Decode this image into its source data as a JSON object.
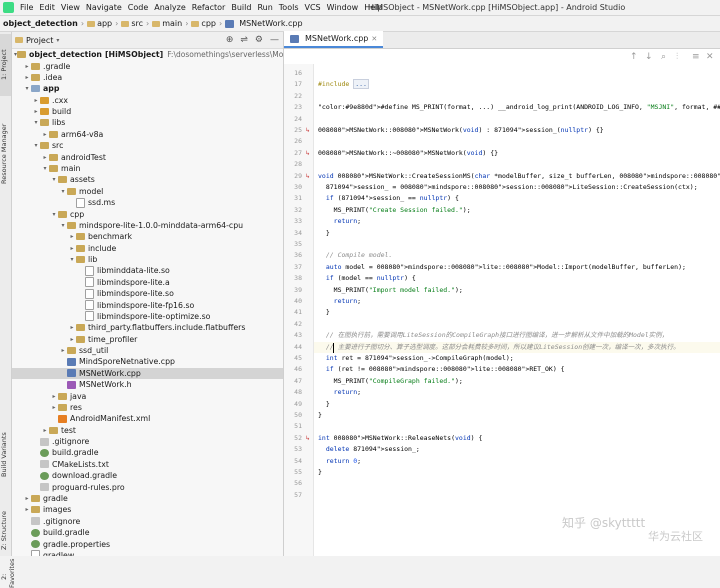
{
  "menubar": {
    "items": [
      "File",
      "Edit",
      "View",
      "Navigate",
      "Code",
      "Analyze",
      "Refactor",
      "Build",
      "Run",
      "Tools",
      "VCS",
      "Window",
      "Help"
    ],
    "window_title": "HiMSObject - MSNetWork.cpp [HiMSObject.app] - Android Studio"
  },
  "breadcrumb": [
    "object_detection",
    "app",
    "src",
    "main",
    "cpp",
    "MSNetWork.cpp"
  ],
  "side_tabs": {
    "project": "1: Project",
    "resource_manager": "Resource Manager",
    "build_variants": "Build Variants",
    "structure": "Z: Structure",
    "favorites": "2: Favorites"
  },
  "project_panel": {
    "title": "Project"
  },
  "tree": [
    {
      "indent": 0,
      "arrow": "▾",
      "icon": "folder",
      "label": "object_detection",
      "bold": true,
      "suffix": "[HiMSObject]",
      "path": "F:\\dosomethings\\serverless\\ModelArts\\Ml"
    },
    {
      "indent": 1,
      "arrow": "▸",
      "icon": "folder",
      "label": ".gradle"
    },
    {
      "indent": 1,
      "arrow": "▸",
      "icon": "folder",
      "label": ".idea"
    },
    {
      "indent": 1,
      "arrow": "▾",
      "icon": "folder-b",
      "label": "app",
      "bold": true
    },
    {
      "indent": 2,
      "arrow": "▸",
      "icon": "folder-o",
      "label": ".cxx"
    },
    {
      "indent": 2,
      "arrow": "▸",
      "icon": "folder-o",
      "label": "build"
    },
    {
      "indent": 2,
      "arrow": "▾",
      "icon": "folder",
      "label": "libs"
    },
    {
      "indent": 3,
      "arrow": "▸",
      "icon": "folder",
      "label": "arm64-v8a"
    },
    {
      "indent": 2,
      "arrow": "▾",
      "icon": "folder",
      "label": "src"
    },
    {
      "indent": 3,
      "arrow": "▸",
      "icon": "folder",
      "label": "androidTest"
    },
    {
      "indent": 3,
      "arrow": "▾",
      "icon": "folder",
      "label": "main"
    },
    {
      "indent": 4,
      "arrow": "▾",
      "icon": "folder",
      "label": "assets"
    },
    {
      "indent": 5,
      "arrow": "▾",
      "icon": "folder",
      "label": "model"
    },
    {
      "indent": 6,
      "arrow": "",
      "icon": "file",
      "label": "ssd.ms"
    },
    {
      "indent": 4,
      "arrow": "▾",
      "icon": "folder",
      "label": "cpp"
    },
    {
      "indent": 5,
      "arrow": "▾",
      "icon": "folder",
      "label": "mindspore-lite-1.0.0-minddata-arm64-cpu"
    },
    {
      "indent": 6,
      "arrow": "▸",
      "icon": "folder",
      "label": "benchmark"
    },
    {
      "indent": 6,
      "arrow": "▸",
      "icon": "folder",
      "label": "include"
    },
    {
      "indent": 6,
      "arrow": "▾",
      "icon": "folder",
      "label": "lib"
    },
    {
      "indent": 7,
      "arrow": "",
      "icon": "file",
      "label": "libminddata-lite.so"
    },
    {
      "indent": 7,
      "arrow": "",
      "icon": "file",
      "label": "libmindspore-lite.a"
    },
    {
      "indent": 7,
      "arrow": "",
      "icon": "file",
      "label": "libmindspore-lite.so"
    },
    {
      "indent": 7,
      "arrow": "",
      "icon": "file",
      "label": "libmindspore-lite-fp16.so"
    },
    {
      "indent": 7,
      "arrow": "",
      "icon": "file",
      "label": "libmindspore-lite-optimize.so"
    },
    {
      "indent": 6,
      "arrow": "▸",
      "icon": "folder",
      "label": "third_party.flatbuffers.include.flatbuffers"
    },
    {
      "indent": 6,
      "arrow": "▸",
      "icon": "folder",
      "label": "time_profiler"
    },
    {
      "indent": 5,
      "arrow": "▸",
      "icon": "folder",
      "label": "ssd_util"
    },
    {
      "indent": 5,
      "arrow": "",
      "icon": "cpp",
      "label": "MindSporeNetnative.cpp"
    },
    {
      "indent": 5,
      "arrow": "",
      "icon": "cpp",
      "label": "MSNetWork.cpp",
      "selected": true
    },
    {
      "indent": 5,
      "arrow": "",
      "icon": "h",
      "label": "MSNetWork.h"
    },
    {
      "indent": 4,
      "arrow": "▸",
      "icon": "folder",
      "label": "java"
    },
    {
      "indent": 4,
      "arrow": "▸",
      "icon": "folder",
      "label": "res"
    },
    {
      "indent": 4,
      "arrow": "",
      "icon": "xml",
      "label": "AndroidManifest.xml"
    },
    {
      "indent": 3,
      "arrow": "▸",
      "icon": "folder",
      "label": "test"
    },
    {
      "indent": 2,
      "arrow": "",
      "icon": "txt",
      "label": ".gitignore"
    },
    {
      "indent": 2,
      "arrow": "",
      "icon": "gradle",
      "label": "build.gradle"
    },
    {
      "indent": 2,
      "arrow": "",
      "icon": "txt",
      "label": "CMakeLists.txt"
    },
    {
      "indent": 2,
      "arrow": "",
      "icon": "gradle",
      "label": "download.gradle"
    },
    {
      "indent": 2,
      "arrow": "",
      "icon": "txt",
      "label": "proguard-rules.pro"
    },
    {
      "indent": 1,
      "arrow": "▸",
      "icon": "folder",
      "label": "gradle"
    },
    {
      "indent": 1,
      "arrow": "▸",
      "icon": "folder",
      "label": "images"
    },
    {
      "indent": 1,
      "arrow": "",
      "icon": "txt",
      "label": ".gitignore"
    },
    {
      "indent": 1,
      "arrow": "",
      "icon": "gradle",
      "label": "build.gradle"
    },
    {
      "indent": 1,
      "arrow": "",
      "icon": "gradle",
      "label": "gradle.properties"
    },
    {
      "indent": 1,
      "arrow": "",
      "icon": "file",
      "label": "gradlew"
    }
  ],
  "editor": {
    "tab_label": "MSNetWork.cpp",
    "lines": [
      {
        "n": "16",
        "text": ""
      },
      {
        "n": "17",
        "text": "#include ...",
        "fold": true
      },
      {
        "n": "22",
        "text": ""
      },
      {
        "n": "23",
        "text": "#define MS_PRINT(format, ...) __android_log_print(ANDROID_LOG_INFO, \"MSJNI\", format, ##__VA_ARGS__)"
      },
      {
        "n": "24",
        "text": ""
      },
      {
        "n": "25",
        "text": "MSNetWork::MSNetWork(void) : session_(nullptr) {}",
        "mark": "↳"
      },
      {
        "n": "26",
        "text": ""
      },
      {
        "n": "27",
        "text": "MSNetWork::~MSNetWork(void) {}",
        "mark": "↳"
      },
      {
        "n": "28",
        "text": ""
      },
      {
        "n": "29",
        "text": "void MSNetWork::CreateSessionMS(char *modelBuffer, size_t bufferLen, mindspore::lite::Context *ctx) {",
        "mark": "↳"
      },
      {
        "n": "30",
        "text": "  session_ = mindspore::session::LiteSession::CreateSession(ctx);"
      },
      {
        "n": "31",
        "text": "  if (session_ == nullptr) {"
      },
      {
        "n": "32",
        "text": "    MS_PRINT(\"Create Session failed.\");"
      },
      {
        "n": "33",
        "text": "    return;"
      },
      {
        "n": "34",
        "text": "  }"
      },
      {
        "n": "35",
        "text": ""
      },
      {
        "n": "36",
        "text": "  // Compile model."
      },
      {
        "n": "37",
        "text": "  auto model = mindspore::lite::Model::Import(modelBuffer, bufferLen);"
      },
      {
        "n": "38",
        "text": "  if (model == nullptr) {"
      },
      {
        "n": "39",
        "text": "    MS_PRINT(\"Import model failed.\");"
      },
      {
        "n": "40",
        "text": "    return;"
      },
      {
        "n": "41",
        "text": "  }"
      },
      {
        "n": "42",
        "text": ""
      },
      {
        "n": "43",
        "text": "  // 在图执行前，需要调用LiteSession的CompileGraph接口进行图编译，进一步解析从文件中加载的Model实例，"
      },
      {
        "n": "44",
        "text": "  // 主要进行子图切分、算子选型调度。这部分会耗费较多时间，所以建议LiteSession创建一次，编译一次，多次执行。",
        "active": true
      },
      {
        "n": "45",
        "text": "  int ret = session_->CompileGraph(model);"
      },
      {
        "n": "46",
        "text": "  if (ret != mindspore::lite::RET_OK) {"
      },
      {
        "n": "47",
        "text": "    MS_PRINT(\"CompileGraph failed.\");"
      },
      {
        "n": "48",
        "text": "    return;"
      },
      {
        "n": "49",
        "text": "  }"
      },
      {
        "n": "50",
        "text": "}"
      },
      {
        "n": "51",
        "text": ""
      },
      {
        "n": "52",
        "text": "int MSNetWork::ReleaseNets(void) {",
        "mark": "↳"
      },
      {
        "n": "53",
        "text": "  delete session_;"
      },
      {
        "n": "54",
        "text": "  return 0;"
      },
      {
        "n": "55",
        "text": "}"
      },
      {
        "n": "56",
        "text": ""
      },
      {
        "n": "57",
        "text": ""
      }
    ]
  },
  "watermark": {
    "line1": "知乎 @skyttttt",
    "line2": "华为云社区"
  }
}
